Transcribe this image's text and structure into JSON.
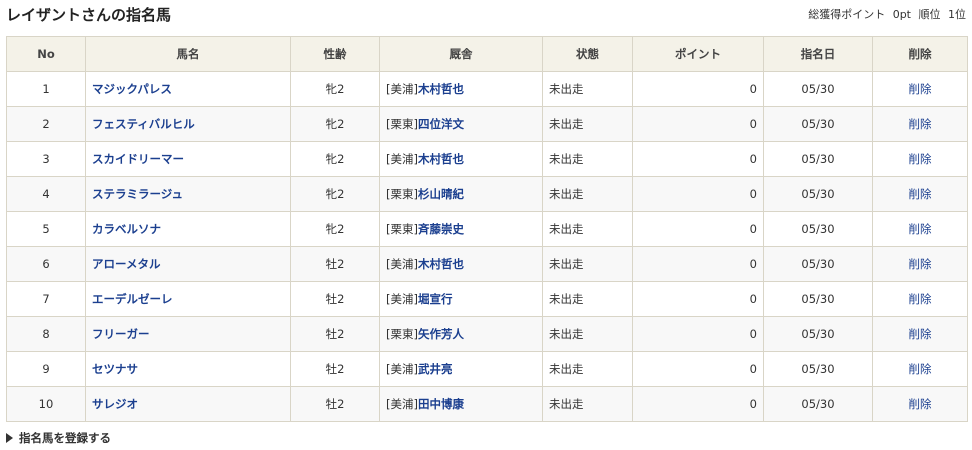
{
  "page": {
    "title": "レイザントさんの指名馬",
    "summary_label": "総獲得ポイント",
    "summary_points": "0pt",
    "rank_label": "順位",
    "rank_value": "1位"
  },
  "table": {
    "headers": [
      "No",
      "馬名",
      "性齢",
      "厩舎",
      "状態",
      "ポイント",
      "指名日",
      "削除"
    ],
    "rows": [
      {
        "no": "1",
        "name": "マジックパレス",
        "sexage": "牝2",
        "region": "[美浦]",
        "trainer": "木村哲也",
        "status": "未出走",
        "points": "0",
        "date": "05/30",
        "delete": "削除"
      },
      {
        "no": "2",
        "name": "フェスティバルヒル",
        "sexage": "牝2",
        "region": "[栗東]",
        "trainer": "四位洋文",
        "status": "未出走",
        "points": "0",
        "date": "05/30",
        "delete": "削除"
      },
      {
        "no": "3",
        "name": "スカイドリーマー",
        "sexage": "牝2",
        "region": "[美浦]",
        "trainer": "木村哲也",
        "status": "未出走",
        "points": "0",
        "date": "05/30",
        "delete": "削除"
      },
      {
        "no": "4",
        "name": "ステラミラージュ",
        "sexage": "牝2",
        "region": "[栗東]",
        "trainer": "杉山晴紀",
        "status": "未出走",
        "points": "0",
        "date": "05/30",
        "delete": "削除"
      },
      {
        "no": "5",
        "name": "カラベルソナ",
        "sexage": "牝2",
        "region": "[栗東]",
        "trainer": "斉藤崇史",
        "status": "未出走",
        "points": "0",
        "date": "05/30",
        "delete": "削除"
      },
      {
        "no": "6",
        "name": "アローメタル",
        "sexage": "牡2",
        "region": "[美浦]",
        "trainer": "木村哲也",
        "status": "未出走",
        "points": "0",
        "date": "05/30",
        "delete": "削除"
      },
      {
        "no": "7",
        "name": "エーデルゼーレ",
        "sexage": "牡2",
        "region": "[美浦]",
        "trainer": "堀宣行",
        "status": "未出走",
        "points": "0",
        "date": "05/30",
        "delete": "削除"
      },
      {
        "no": "8",
        "name": "フリーガー",
        "sexage": "牡2",
        "region": "[栗東]",
        "trainer": "矢作芳人",
        "status": "未出走",
        "points": "0",
        "date": "05/30",
        "delete": "削除"
      },
      {
        "no": "9",
        "name": "セツナサ",
        "sexage": "牡2",
        "region": "[美浦]",
        "trainer": "武井亮",
        "status": "未出走",
        "points": "0",
        "date": "05/30",
        "delete": "削除"
      },
      {
        "no": "10",
        "name": "サレジオ",
        "sexage": "牡2",
        "region": "[美浦]",
        "trainer": "田中博康",
        "status": "未出走",
        "points": "0",
        "date": "05/30",
        "delete": "削除"
      }
    ]
  },
  "footer": {
    "register_link": "指名馬を登録する",
    "register_icon": "triangle-right-icon"
  },
  "colors": {
    "link": "#1b3f8f",
    "header_bg": "#f4f2e8",
    "border": "#d9d5c7",
    "zebra": "#f8f8f8"
  }
}
